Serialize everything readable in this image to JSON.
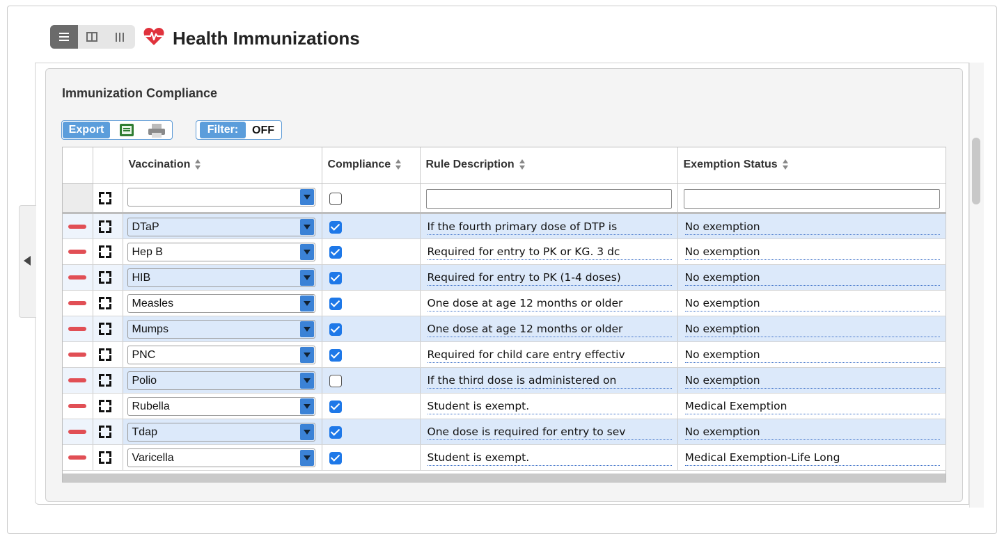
{
  "page": {
    "title": "Health Immunizations",
    "section_title": "Immunization Compliance"
  },
  "toolbar": {
    "export_label": "Export",
    "filter_label": "Filter:",
    "filter_value": "OFF"
  },
  "table": {
    "columns": [
      "Vaccination",
      "Compliance",
      "Rule Description",
      "Exemption Status"
    ],
    "rows": [
      {
        "vaccination": "DTaP",
        "compliance": true,
        "rule": "If the fourth primary dose of DTP is",
        "exemption": "No exemption"
      },
      {
        "vaccination": "Hep B",
        "compliance": true,
        "rule": "Required for entry to PK or KG. 3 dc",
        "exemption": "No exemption"
      },
      {
        "vaccination": "HIB",
        "compliance": true,
        "rule": "Required for entry to PK (1-4 doses)",
        "exemption": "No exemption"
      },
      {
        "vaccination": "Measles",
        "compliance": true,
        "rule": "One dose at age 12 months or older",
        "exemption": "No exemption"
      },
      {
        "vaccination": "Mumps",
        "compliance": true,
        "rule": "One dose at age 12 months or older",
        "exemption": "No exemption"
      },
      {
        "vaccination": "PNC",
        "compliance": true,
        "rule": "Required for child care entry effectiv",
        "exemption": "No exemption"
      },
      {
        "vaccination": "Polio",
        "compliance": false,
        "rule": "If the third dose is administered on",
        "exemption": "No exemption"
      },
      {
        "vaccination": "Rubella",
        "compliance": true,
        "rule": "Student is exempt.",
        "exemption": "Medical Exemption"
      },
      {
        "vaccination": "Tdap",
        "compliance": true,
        "rule": "One dose is required for entry to sev",
        "exemption": "No exemption"
      },
      {
        "vaccination": "Varicella",
        "compliance": true,
        "rule": "Student is exempt.",
        "exemption": "Medical Exemption-Life Long"
      }
    ]
  },
  "colors": {
    "accent": "#5b9ddb",
    "row_highlight": "#dce9fa",
    "delete": "#e14f55",
    "checkbox": "#1e78e8",
    "heart": "#e0323c"
  },
  "icons": [
    "list-view-icon",
    "split-view-icon",
    "columns-view-icon",
    "heartbeat-icon",
    "excel-icon",
    "print-icon",
    "delete-row-icon",
    "expand-row-icon",
    "dropdown-arrow-icon",
    "collapse-left-icon"
  ]
}
